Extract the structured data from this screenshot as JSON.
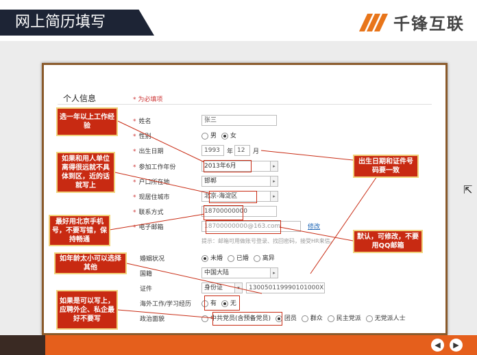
{
  "header": {
    "title": "网上简历填写",
    "logo_text": "千锋互联"
  },
  "form": {
    "section_title": "个人信息",
    "required_note": "* 为必填项",
    "fields": {
      "name_label": "姓名",
      "name_value": "张三",
      "gender_label": "性别",
      "gender_male": "男",
      "gender_female": "女",
      "birth_label": "出生日期",
      "birth_year": "1993",
      "birth_year_unit": "年",
      "birth_month": "12",
      "birth_month_unit": "月",
      "workstart_label": "参加工作年份",
      "workstart_value": "2013年6月",
      "hukou_label": "户口所在地",
      "hukou_value": "邯郸",
      "city_label": "现居住城市",
      "city_value": "北京-海淀区",
      "phone_label": "联系方式",
      "phone_value": "18700000000",
      "email_label": "电子邮箱",
      "email_value": "18700000000@163.com",
      "email_edit": "修改",
      "email_hint": "提示：邮箱可用做账号登录、找回密码，接受HR来信。",
      "marital_label": "婚姻状况",
      "marital_single": "未婚",
      "marital_married": "已婚",
      "marital_divorced": "离异",
      "nation_label": "国籍",
      "nation_value": "中国大陆",
      "id_label": "证件",
      "id_type": "身份证",
      "id_value": "130050119990101000X",
      "abroad_label": "海外工作/学习经历",
      "abroad_yes": "有",
      "abroad_no": "无",
      "political_label": "政治面貌",
      "political_opt1": "中共党员(含预备党员)",
      "political_opt2": "团员",
      "political_opt3": "群众",
      "political_opt4": "民主党派",
      "political_opt5": "无党派人士"
    }
  },
  "callouts": {
    "work_year": "选一年以上工作经验",
    "city": "如果和用人单位离得很远就不具体到区，近的话就写上",
    "phone": "最好用北京手机号，不要写错，保持畅通",
    "age": "如年龄太小可以选择其他",
    "political": "如果是可以写上，应聘外企、私企最好不要写",
    "birth": "出生日期和证件号码要一致",
    "email": "默认，可修改，不要用QQ邮箱"
  },
  "nav": {
    "prev_icon": "left-arrow-icon",
    "next_icon": "right-arrow-icon"
  },
  "colors": {
    "accent": "#e55f1c",
    "callout": "#c82a12",
    "banner": "#1d2435"
  }
}
